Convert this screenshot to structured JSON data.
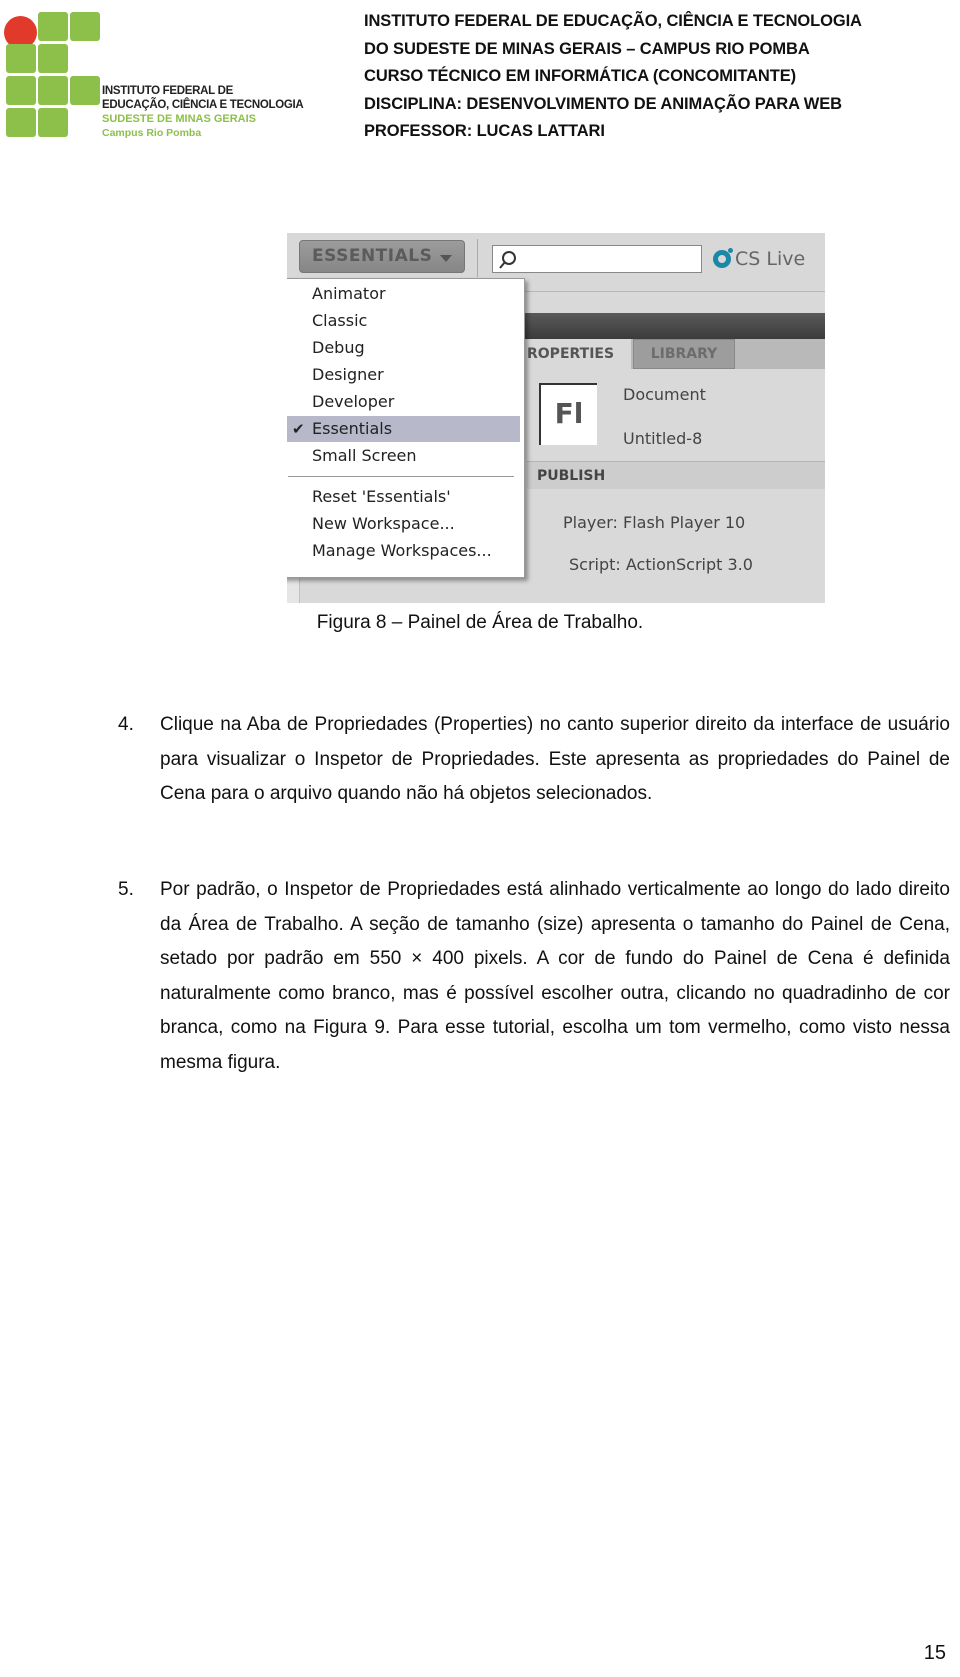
{
  "header": {
    "logo": {
      "icon": "ifet-logo-grid-icon",
      "colors": {
        "green": "#8dc04a",
        "red": "#e23a2a"
      },
      "lines": [
        "INSTITUTO FEDERAL DE",
        "EDUCAÇÃO, CIÊNCIA E TECNOLOGIA",
        "SUDESTE DE MINAS GERAIS",
        "Campus Rio Pomba"
      ]
    },
    "lines": [
      "INSTITUTO FEDERAL DE EDUCAÇÃO, CIÊNCIA E TECNOLOGIA",
      "DO SUDESTE DE MINAS GERAIS – CAMPUS RIO POMBA",
      "CURSO TÉCNICO EM INFORMÁTICA (CONCOMITANTE)",
      "DISCIPLINA: DESENVOLVIMENTO DE ANIMAÇÃO PARA WEB",
      "PROFESSOR: LUCAS LATTARI"
    ]
  },
  "figure": {
    "workspace_button": {
      "label": "ESSENTIALS",
      "icon": "caret-down-icon"
    },
    "search": {
      "value": "",
      "icon": "search-icon"
    },
    "cs_live": {
      "label": "CS Live",
      "icon": "cs-live-icon"
    },
    "tabs": [
      {
        "label": "PROPERTIES",
        "visible_label": "ROPERTIES",
        "active": true
      },
      {
        "label": "LIBRARY",
        "active": false
      }
    ],
    "document": {
      "icon_label": "Fl",
      "type": "Document",
      "name": "Untitled-8"
    },
    "publish": {
      "section_label": "PUBLISH",
      "player": "Player: Flash Player 10",
      "script": "Script: ActionScript 3.0"
    },
    "menu": {
      "items": [
        {
          "label": "Animator",
          "selected": false
        },
        {
          "label": "Classic",
          "selected": false
        },
        {
          "label": "Debug",
          "selected": false
        },
        {
          "label": "Designer",
          "selected": false
        },
        {
          "label": "Developer",
          "selected": false
        },
        {
          "label": "Essentials",
          "selected": true,
          "check": "✔"
        },
        {
          "label": "Small Screen",
          "selected": false
        }
      ],
      "actions": [
        {
          "label": "Reset 'Essentials'"
        },
        {
          "label": "New Workspace..."
        },
        {
          "label": "Manage Workspaces..."
        }
      ]
    }
  },
  "caption": "Figura 8 – Painel de Área de Trabalho.",
  "paragraphs": [
    {
      "number": "4.",
      "text": "Clique na Aba de Propriedades (Properties) no canto superior direito da interface de usuário para visualizar o Inspetor de Propriedades. Este apresenta as propriedades do Painel de Cena para o arquivo quando não há objetos selecionados."
    },
    {
      "number": "5.",
      "text": "Por padrão, o Inspetor de Propriedades está alinhado verticalmente ao longo do lado direito da Área de Trabalho. A seção de tamanho (size) apresenta o tamanho do Painel de Cena, setado por padrão em 550 × 400 pixels. A cor de fundo do Painel de Cena é definida naturalmente como branco, mas é possível escolher outra, clicando no quadradinho de cor branca, como na Figura 9. Para esse tutorial, escolha um tom vermelho, como visto nessa mesma figura."
    }
  ],
  "page_number": "15"
}
